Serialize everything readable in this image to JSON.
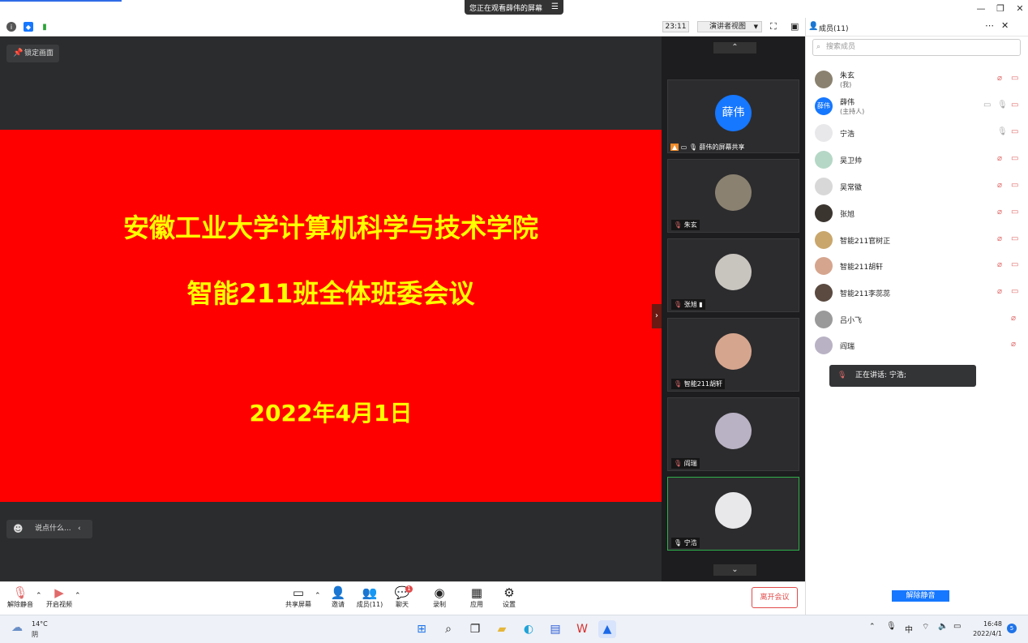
{
  "title_bar": {
    "sharing_banner": "您正在观看薛伟的屏幕",
    "banner_menu_icon": "menu-icon",
    "window_controls": [
      "minimize-icon",
      "restore-icon",
      "close-icon"
    ]
  },
  "toolbar": {
    "timer": "23:11",
    "view_mode": "演讲者视图",
    "panel_title": "成员(11)"
  },
  "stage": {
    "lock_label": "锁定画面",
    "slide_title": "安徽工业大学计算机科学与技术学院",
    "slide_subtitle": "智能211班全体班委会议",
    "slide_date": "2022年4月1日",
    "chat_placeholder": "说点什么..."
  },
  "video_strip": [
    {
      "name": "薛伟的屏幕共享",
      "avatar_text": "薛伟"
    },
    {
      "name": "朱玄"
    },
    {
      "name": "张旭"
    },
    {
      "name": "智能211胡轩"
    },
    {
      "name": "阎瑞"
    },
    {
      "name": "宁浩"
    }
  ],
  "panel": {
    "search_placeholder": "搜索成员",
    "members": [
      {
        "name": "朱玄",
        "sub": "(我)"
      },
      {
        "name": "薛伟",
        "sub": "(主持人)",
        "avatar_text": "薛伟"
      },
      {
        "name": "宁浩"
      },
      {
        "name": "吴卫帅"
      },
      {
        "name": "吴常徽"
      },
      {
        "name": "张旭"
      },
      {
        "name": "智能211官树正"
      },
      {
        "name": "智能211胡轩"
      },
      {
        "name": "智能211李蕊蕊"
      },
      {
        "name": "吕小飞"
      },
      {
        "name": "阎瑞"
      }
    ],
    "speaking": "正在讲话: 宁浩;",
    "unmute_all": "解除静音"
  },
  "bottom_toolbar": {
    "unmute": "解除静音",
    "video": "开启视频",
    "share": "共享屏幕",
    "invite": "邀请",
    "members": "成员(11)",
    "chat": "聊天",
    "record": "录制",
    "apps": "应用",
    "settings": "设置",
    "leave": "离开会议",
    "chat_badge": "1"
  },
  "taskbar": {
    "weather_temp": "14°C",
    "weather_desc": "阴",
    "ime": "中",
    "time": "16:48",
    "date": "2022/4/1",
    "notification_count": "5"
  },
  "colors": {
    "slide_bg": "#fe0000",
    "slide_text": "#ffff00",
    "accent": "#1677ff",
    "leave": "#e24a4a"
  }
}
